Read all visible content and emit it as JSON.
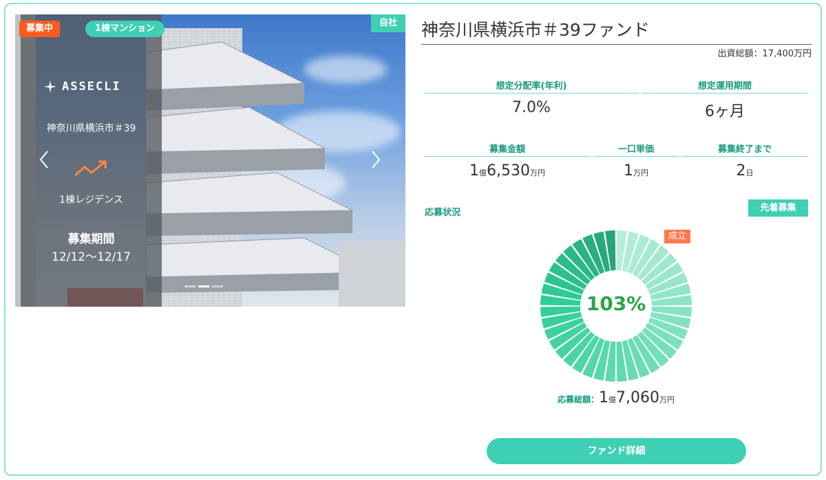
{
  "badges": {
    "status": "募集中",
    "property_type": "1棟マンション",
    "ownership": "自社"
  },
  "photo_overlay": {
    "logo_text": "ASSECLI",
    "location": "神奈川県横浜市＃39",
    "kind": "1棟レジデンス",
    "period_label": "募集期間",
    "period": "12/12〜12/17",
    "prev_icon": "chevron-left-icon",
    "next_icon": "chevron-right-icon",
    "slide_count": 3,
    "active_slide": 1
  },
  "fund": {
    "title": "神奈川県横浜市＃39ファンド",
    "total_investment": "出資総額：17,400万円"
  },
  "stats": {
    "yield_label": "想定分配率(年利)",
    "yield_value": "7.0%",
    "period_label": "想定運用期間",
    "period_value": "6ヶ月",
    "amount_label": "募集金額",
    "amount_oku": "1",
    "amount_oku_unit": "億",
    "amount_man": "6,530",
    "amount_man_unit": "万円",
    "unit_price_label": "一口単価",
    "unit_price_value": "1",
    "unit_price_unit": "万円",
    "remaining_label": "募集終了まで",
    "remaining_value": "2",
    "remaining_unit": "日"
  },
  "application": {
    "label": "応募状況",
    "method": "先着募集",
    "established": "成立",
    "percent": "103%",
    "percent_value": 103,
    "total_label": "応募総額：",
    "total_oku": "1",
    "total_oku_unit": "億",
    "total_man": "7,060",
    "total_man_unit": "万円"
  },
  "actions": {
    "detail_button": "ファンド詳細"
  },
  "colors": {
    "accent": "#3fcfb4",
    "label_green": "#1a9a7e",
    "recruit_orange": "#ff5a1f",
    "established_orange": "#ff7a4f",
    "percent_green": "#2aa54a"
  }
}
